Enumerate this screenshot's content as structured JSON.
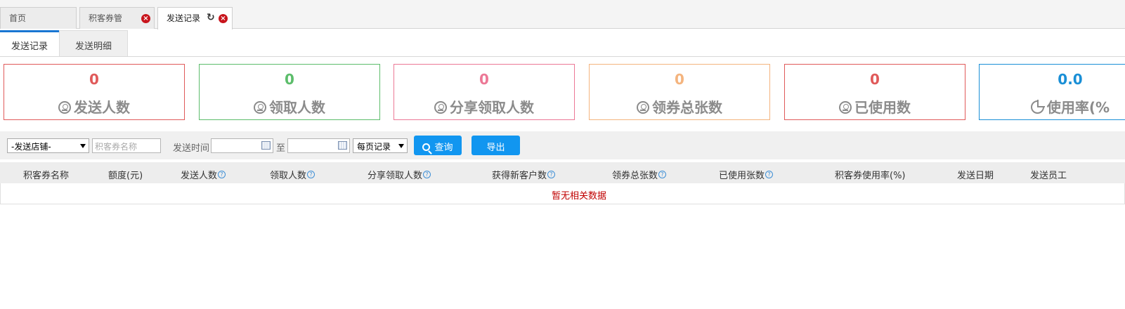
{
  "top_tabs": {
    "home": "首页",
    "points_coupon": "积客券管",
    "send_records": "发送记录"
  },
  "sub_tabs": {
    "records": "发送记录",
    "details": "发送明细"
  },
  "stats": [
    {
      "value": "0",
      "label": "发送人数",
      "icon": "person-icon",
      "color": "#e05a5a"
    },
    {
      "value": "0",
      "label": "领取人数",
      "icon": "person-icon",
      "color": "#5cbd6b"
    },
    {
      "value": "0",
      "label": "分享领取人数",
      "icon": "person-icon",
      "color": "#ec7896"
    },
    {
      "value": "0",
      "label": "领券总张数",
      "icon": "person-icon",
      "color": "#f4b47e"
    },
    {
      "value": "0",
      "label": "已使用数",
      "icon": "person-icon",
      "color": "#e05a5a"
    },
    {
      "value": "0.0",
      "label": "使用率(%",
      "icon": "pie-chart-icon",
      "color": "#1a8fd6"
    }
  ],
  "filters": {
    "store_select": "-发送店铺-",
    "coupon_name_placeholder": "积客券名称",
    "send_time_label": "发送时间",
    "to_label": "至",
    "page_size_select": "每页记录",
    "search_button": "查询",
    "export_button": "导出"
  },
  "table": {
    "columns": [
      {
        "label": "积客券名称",
        "help": false
      },
      {
        "label": "额度(元)",
        "help": false
      },
      {
        "label": "发送人数",
        "help": true
      },
      {
        "label": "领取人数",
        "help": true
      },
      {
        "label": "分享领取人数",
        "help": true
      },
      {
        "label": "获得新客户数",
        "help": true
      },
      {
        "label": "领券总张数",
        "help": true
      },
      {
        "label": "已使用张数",
        "help": true
      },
      {
        "label": "积客券使用率(%)",
        "help": false
      },
      {
        "label": "发送日期",
        "help": false
      },
      {
        "label": "发送员工",
        "help": false
      }
    ],
    "help_glyph": "?",
    "empty_message": "暂无相关数据"
  }
}
